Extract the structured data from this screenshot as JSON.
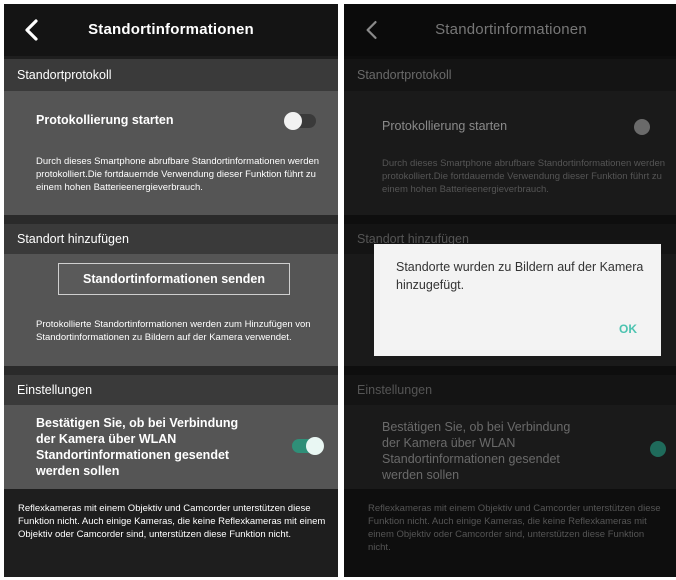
{
  "left_screen": {
    "title": "Standortinformationen",
    "sections": [
      {
        "header": "Standortprotokoll"
      },
      {
        "header": "Standort hinzufügen"
      },
      {
        "header": "Einstellungen"
      }
    ],
    "logging": {
      "label": "Protokollierung starten",
      "toggle_on": false,
      "description": "Durch dieses Smartphone abrufbare Standortinformationen werden protokolliert.Die fortdauernde Verwendung dieser Funktion führt zu einem hohen Batterieenergieverbrauch."
    },
    "add_location": {
      "button_label": "Standortinformationen senden",
      "description": "Protokollierte Standortinformationen werden zum Hinzufügen von Standortinformationen zu Bildern auf der Kamera verwendet."
    },
    "settings": {
      "label": "Bestätigen Sie, ob bei Verbindung der Kamera über WLAN Standortinformationen gesendet werden sollen",
      "toggle_on": true
    },
    "footer_note": "Reflexkameras mit einem Objektiv und Camcorder unterstützen diese Funktion nicht. Auch einige Kameras, die keine Reflexkameras mit einem Objektiv oder Camcorder sind, unterstützen diese Funktion nicht."
  },
  "right_screen": {
    "title": "Standortinformationen",
    "sections": [
      {
        "header": "Standortprotokoll"
      },
      {
        "header": "Standort hinzufügen"
      },
      {
        "header": "Einstellungen"
      }
    ],
    "logging_label": "Protokollierung starten",
    "logging_description": "Durch dieses Smartphone abrufbare Standortinformationen werden protokolliert.Die fortdauernde Verwendung dieser Funktion führt zu einem hohen Batterieenergieverbrauch.",
    "settings_label": "Bestätigen Sie, ob bei Verbindung der Kamera über WLAN Standortinformationen gesendet werden sollen",
    "footer_note": "Reflexkameras mit einem Objektiv und Camcorder unterstützen diese Funktion nicht. Auch einige Kameras, die keine Reflexkameras mit einem Objektiv oder Camcorder sind, unterstützen diese Funktion nicht.",
    "dialog": {
      "message": "Standorte wurden zu Bildern auf der Kamera hinzugefügt.",
      "ok_label": "OK"
    }
  },
  "colors": {
    "accent_teal": "#3ec9a7",
    "panel_gray": "#555555",
    "header_gray": "#3a3a3a",
    "background_dark": "#1e1e1e"
  },
  "icons": {
    "back": "chevron-left-icon"
  }
}
